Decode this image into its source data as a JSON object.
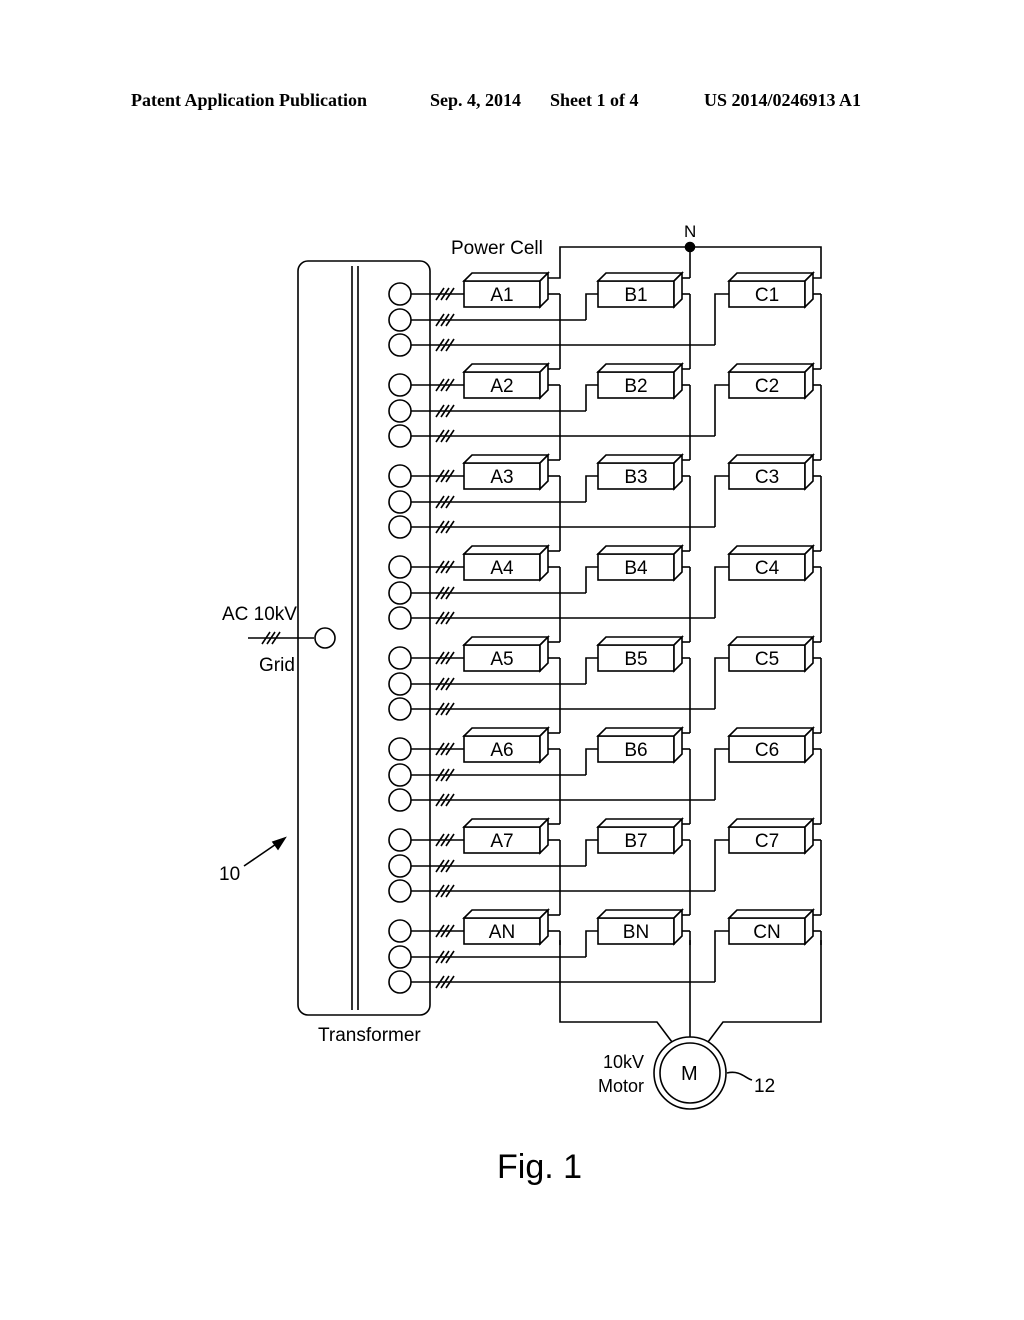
{
  "header": {
    "publication_type": "Patent Application Publication",
    "date": "Sep. 4, 2014",
    "sheet": "Sheet 1 of 4",
    "patent_number": "US 2014/0246913 A1"
  },
  "diagram": {
    "power_cell_label": "Power Cell",
    "neutral_label": "N",
    "grid_voltage_label": "AC 10kV",
    "grid_label": "Grid",
    "transformer_label": "Transformer",
    "system_ref": "10",
    "motor_voltage": "10kV",
    "motor_word": "Motor",
    "motor_symbol": "M",
    "motor_ref": "12",
    "phases": [
      "A",
      "B",
      "C"
    ],
    "row_suffixes": [
      "1",
      "2",
      "3",
      "4",
      "5",
      "6",
      "7",
      "N"
    ],
    "cells": [
      [
        "A1",
        "B1",
        "C1"
      ],
      [
        "A2",
        "B2",
        "C2"
      ],
      [
        "A3",
        "B3",
        "C3"
      ],
      [
        "A4",
        "B4",
        "C4"
      ],
      [
        "A5",
        "B5",
        "C5"
      ],
      [
        "A6",
        "B6",
        "C6"
      ],
      [
        "A7",
        "B7",
        "C7"
      ],
      [
        "AN",
        "BN",
        "CN"
      ]
    ],
    "three_phase_mark": "///"
  },
  "caption": "Fig. 1"
}
